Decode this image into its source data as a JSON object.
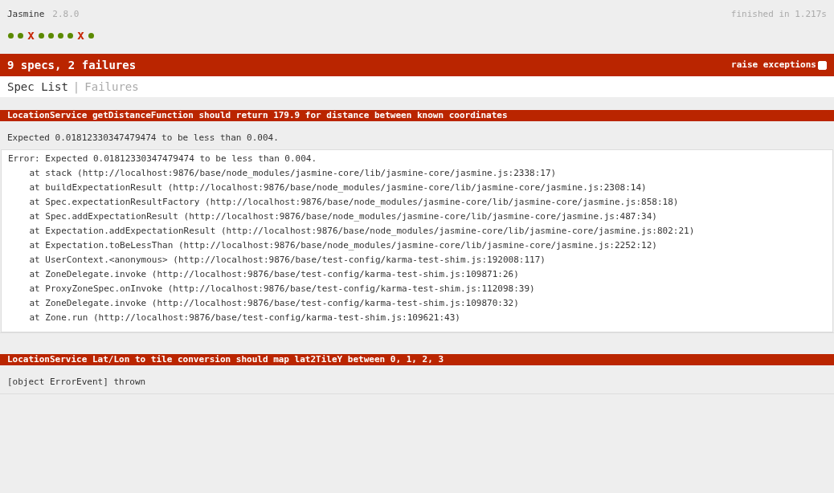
{
  "banner": {
    "title": "Jasmine",
    "version": "2.8.0",
    "duration": "finished in 1.217s"
  },
  "symbols": [
    {
      "kind": "passed"
    },
    {
      "kind": "passed"
    },
    {
      "kind": "failed",
      "text": "x"
    },
    {
      "kind": "passed"
    },
    {
      "kind": "passed"
    },
    {
      "kind": "passed"
    },
    {
      "kind": "passed"
    },
    {
      "kind": "failed",
      "text": "x"
    },
    {
      "kind": "passed"
    }
  ],
  "summary": {
    "text": "9 specs, 2 failures",
    "option": {
      "label": "raise exceptions",
      "checked": false
    }
  },
  "tabs": [
    {
      "label": "Spec List",
      "selected": true
    },
    {
      "label": "Failures",
      "selected": false
    }
  ],
  "separator": "|",
  "failures": [
    {
      "title": "LocationService getDistanceFunction should return 179.9 for distance between known coordinates",
      "message": "Expected 0.01812330347479474 to be less than 0.004.",
      "stack": [
        "Error: Expected 0.01812330347479474 to be less than 0.004.",
        "    at stack (http://localhost:9876/base/node_modules/jasmine-core/lib/jasmine-core/jasmine.js:2338:17)",
        "    at buildExpectationResult (http://localhost:9876/base/node_modules/jasmine-core/lib/jasmine-core/jasmine.js:2308:14)",
        "    at Spec.expectationResultFactory (http://localhost:9876/base/node_modules/jasmine-core/lib/jasmine-core/jasmine.js:858:18)",
        "    at Spec.addExpectationResult (http://localhost:9876/base/node_modules/jasmine-core/lib/jasmine-core/jasmine.js:487:34)",
        "    at Expectation.addExpectationResult (http://localhost:9876/base/node_modules/jasmine-core/lib/jasmine-core/jasmine.js:802:21)",
        "    at Expectation.toBeLessThan (http://localhost:9876/base/node_modules/jasmine-core/lib/jasmine-core/jasmine.js:2252:12)",
        "    at UserContext.<anonymous> (http://localhost:9876/base/test-config/karma-test-shim.js:192008:117)",
        "    at ZoneDelegate.invoke (http://localhost:9876/base/test-config/karma-test-shim.js:109871:26)",
        "    at ProxyZoneSpec.onInvoke (http://localhost:9876/base/test-config/karma-test-shim.js:112098:39)",
        "    at ZoneDelegate.invoke (http://localhost:9876/base/test-config/karma-test-shim.js:109870:32)",
        "    at Zone.run (http://localhost:9876/base/test-config/karma-test-shim.js:109621:43)"
      ]
    },
    {
      "title": "LocationService Lat/Lon to tile conversion should map lat2TileY between 0, 1, 2, 3",
      "message": "[object ErrorEvent] thrown"
    }
  ]
}
